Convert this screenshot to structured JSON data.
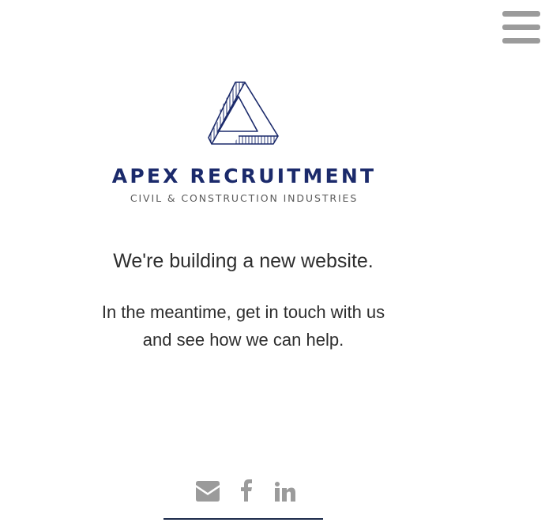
{
  "header": {
    "menu_icon": "hamburger-menu-icon"
  },
  "brand": {
    "logo_icon": "impossible-triangle-logo-icon",
    "name": "APEX RECRUITMENT",
    "tagline": "CIVIL & CONSTRUCTION INDUSTRIES",
    "brand_color": "#1b2a6b",
    "tagline_color": "#5a5a5a"
  },
  "main": {
    "headline": "We're building a new website.",
    "message_lines": [
      "In the meantime, get in touch with us",
      "and see how we can help."
    ]
  },
  "social": {
    "icon_color": "#9b9b9b",
    "links": [
      {
        "icon": "envelope-icon"
      },
      {
        "icon": "facebook-icon"
      },
      {
        "icon": "linkedin-icon"
      }
    ]
  }
}
